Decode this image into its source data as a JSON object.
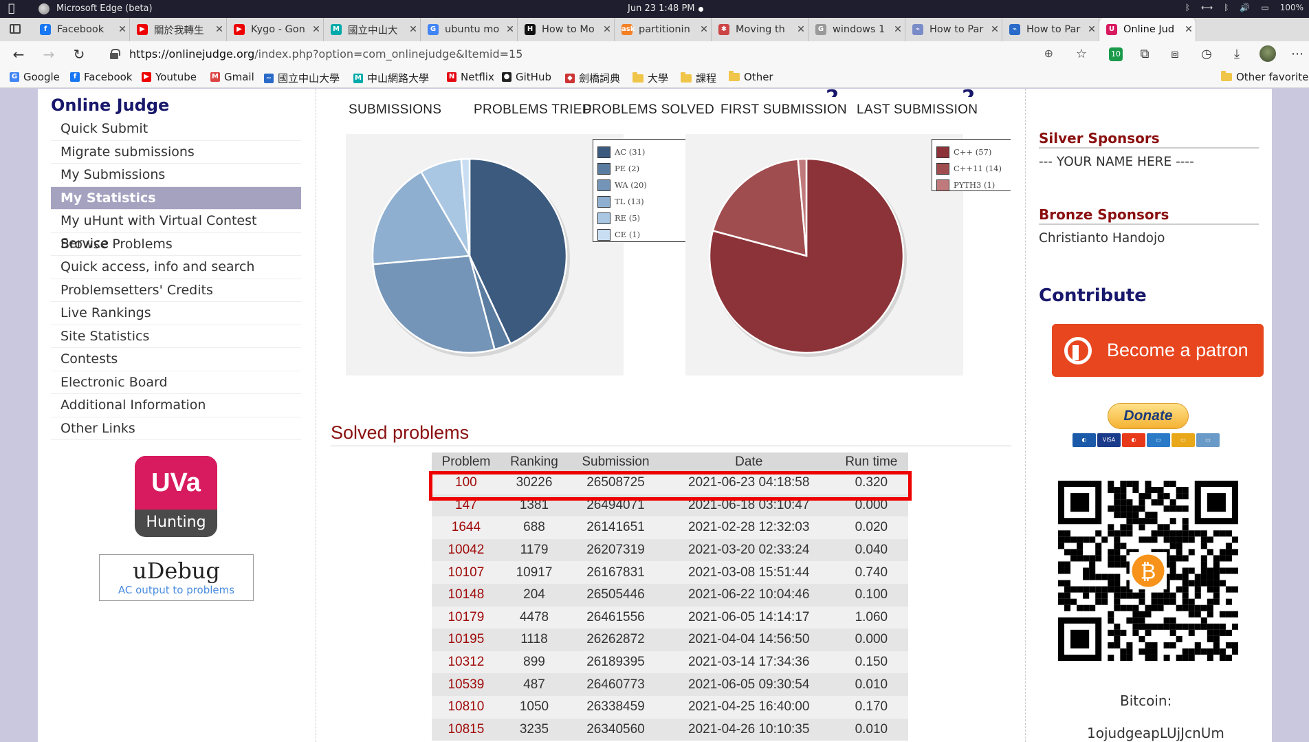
{
  "menubar": {
    "app_name": "Microsoft Edge (beta)",
    "clock": "Jun 23   1:48 PM",
    "battery": "100%"
  },
  "tabs": [
    {
      "title": "Facebook",
      "fav_color": "#1877f2",
      "fav_glyph": "f"
    },
    {
      "title": "關於我轉生",
      "fav_color": "#e00",
      "fav_glyph": "▶"
    },
    {
      "title": "Kygo - Gon",
      "fav_color": "#e00",
      "fav_glyph": "▶"
    },
    {
      "title": "國立中山大",
      "fav_color": "#0aa",
      "fav_glyph": "M"
    },
    {
      "title": "ubuntu mo",
      "fav_color": "#4285f4",
      "fav_glyph": "G"
    },
    {
      "title": "How to Mo",
      "fav_color": "#111",
      "fav_glyph": "H"
    },
    {
      "title": "partitionin",
      "fav_color": "#f48024",
      "fav_glyph": "ask"
    },
    {
      "title": "Moving th",
      "fav_color": "#c44",
      "fav_glyph": "✱"
    },
    {
      "title": "windows 1",
      "fav_color": "#999",
      "fav_glyph": "G"
    },
    {
      "title": "How to Par",
      "fav_color": "#7a8cc8",
      "fav_glyph": "⌁"
    },
    {
      "title": "How to Par",
      "fav_color": "#2a6ac8",
      "fav_glyph": "⌁"
    },
    {
      "title": "Online Jud",
      "fav_color": "#d81a5f",
      "fav_glyph": "U",
      "active": true
    }
  ],
  "address": {
    "url_host": "https://onlinejudge.org",
    "url_path": "/index.php?option=com_onlinejudge&Itemid=15"
  },
  "bookmarks": [
    {
      "label": "Google",
      "icon": "google-icon",
      "color": "#4285f4",
      "glyph": "G"
    },
    {
      "label": "Facebook",
      "icon": "facebook-icon",
      "color": "#1877f2",
      "glyph": "f"
    },
    {
      "label": "Youtube",
      "icon": "youtube-icon",
      "color": "#e00",
      "glyph": "▶"
    },
    {
      "label": "Gmail",
      "icon": "gmail-icon",
      "color": "#d44",
      "glyph": "M"
    },
    {
      "label": "國立中山大學",
      "icon": "nsysu-icon",
      "color": "#2a6ac8",
      "glyph": "~"
    },
    {
      "label": "中山網路大學",
      "icon": "cyber-univ-icon",
      "color": "#0aa",
      "glyph": "M"
    },
    {
      "label": "Netflix",
      "icon": "netflix-icon",
      "color": "#e50914",
      "glyph": "N"
    },
    {
      "label": "GitHub",
      "icon": "github-icon",
      "color": "#222",
      "glyph": "●"
    },
    {
      "label": "劍橋詞典",
      "icon": "cambridge-icon",
      "color": "#c33",
      "glyph": "◆"
    },
    {
      "label": "大學",
      "icon": "folder-icon",
      "folder": true
    },
    {
      "label": "課程",
      "icon": "folder-icon",
      "folder": true
    },
    {
      "label": "Other",
      "icon": "folder-icon",
      "folder": true
    }
  ],
  "other_favorites": "Other favorites",
  "site": {
    "title": "Online Judge",
    "nav": [
      {
        "label": "Quick Submit"
      },
      {
        "label": "Migrate submissions"
      },
      {
        "label": "My Submissions"
      },
      {
        "label": "My Statistics",
        "active": true
      },
      {
        "label": "My uHunt with Virtual Contest Service"
      },
      {
        "label": "Browse Problems"
      },
      {
        "label": "Quick access, info and search"
      },
      {
        "label": "Problemsetters' Credits"
      },
      {
        "label": "Live Rankings"
      },
      {
        "label": "Site Statistics"
      },
      {
        "label": "Contests"
      },
      {
        "label": "Electronic Board"
      },
      {
        "label": "Additional Information"
      },
      {
        "label": "Other Links"
      }
    ],
    "uva_badge": {
      "top": "UVa",
      "bottom": "Hunting"
    },
    "udebug": {
      "logo": "uDebug",
      "sub": "AC output to problems"
    }
  },
  "stats": {
    "headers": [
      "SUBMISSIONS",
      "PROBLEMS TRIED",
      "PROBLEMS SOLVED",
      "FIRST SUBMISSION",
      "LAST SUBMISSION"
    ]
  },
  "chart_data": [
    {
      "type": "pie",
      "labels": [
        "AC (31)",
        "PE (2)",
        "WA (20)",
        "TL (13)",
        "RE (5)",
        "CE (1)"
      ],
      "values": [
        31,
        2,
        20,
        13,
        5,
        1
      ],
      "colors": [
        "#3b5a7e",
        "#5a7ca0",
        "#7495b8",
        "#8eafcf",
        "#a9c7e3",
        "#c9def2"
      ],
      "legend": "top-right"
    },
    {
      "type": "pie",
      "labels": [
        "C++ (57)",
        "C++11 (14)",
        "PYTH3 (1)"
      ],
      "values": [
        57,
        14,
        1
      ],
      "colors": [
        "#8b3338",
        "#a04d50",
        "#c07a7c"
      ],
      "legend": "top-right"
    }
  ],
  "solved": {
    "title": "Solved problems",
    "columns": [
      "Problem",
      "Ranking",
      "Submission",
      "Date",
      "Run time"
    ],
    "rows": [
      [
        "100",
        "30226",
        "26508725",
        "2021-06-23 04:18:58",
        "0.320"
      ],
      [
        "147",
        "1381",
        "26494071",
        "2021-06-18 03:10:47",
        "0.000"
      ],
      [
        "1644",
        "688",
        "26141651",
        "2021-02-28 12:32:03",
        "0.020"
      ],
      [
        "10042",
        "1179",
        "26207319",
        "2021-03-20 02:33:24",
        "0.040"
      ],
      [
        "10107",
        "10917",
        "26167831",
        "2021-03-08 15:51:44",
        "0.740"
      ],
      [
        "10148",
        "204",
        "26505446",
        "2021-06-22 10:04:46",
        "0.100"
      ],
      [
        "10179",
        "4478",
        "26461556",
        "2021-06-05 14:14:17",
        "1.060"
      ],
      [
        "10195",
        "1118",
        "26262872",
        "2021-04-04 14:56:50",
        "0.000"
      ],
      [
        "10312",
        "899",
        "26189395",
        "2021-03-14 17:34:36",
        "0.150"
      ],
      [
        "10539",
        "487",
        "26460773",
        "2021-06-05 09:30:54",
        "0.010"
      ],
      [
        "10810",
        "1050",
        "26338459",
        "2021-04-25 16:40:00",
        "0.170"
      ],
      [
        "10815",
        "3235",
        "26340560",
        "2021-04-26 10:10:35",
        "0.010"
      ]
    ]
  },
  "sidebar_right": {
    "silver_title": "Silver Sponsors",
    "silver_text": "--- YOUR NAME HERE ----",
    "bronze_title": "Bronze Sponsors",
    "bronze_text": "Christianto Handojo",
    "contribute": "Contribute",
    "patron": "Become a patron",
    "donate": "Donate",
    "bitcoin_label": "Bitcoin:",
    "bitcoin_addr": "1ojudgeapLUjJcnUm"
  }
}
